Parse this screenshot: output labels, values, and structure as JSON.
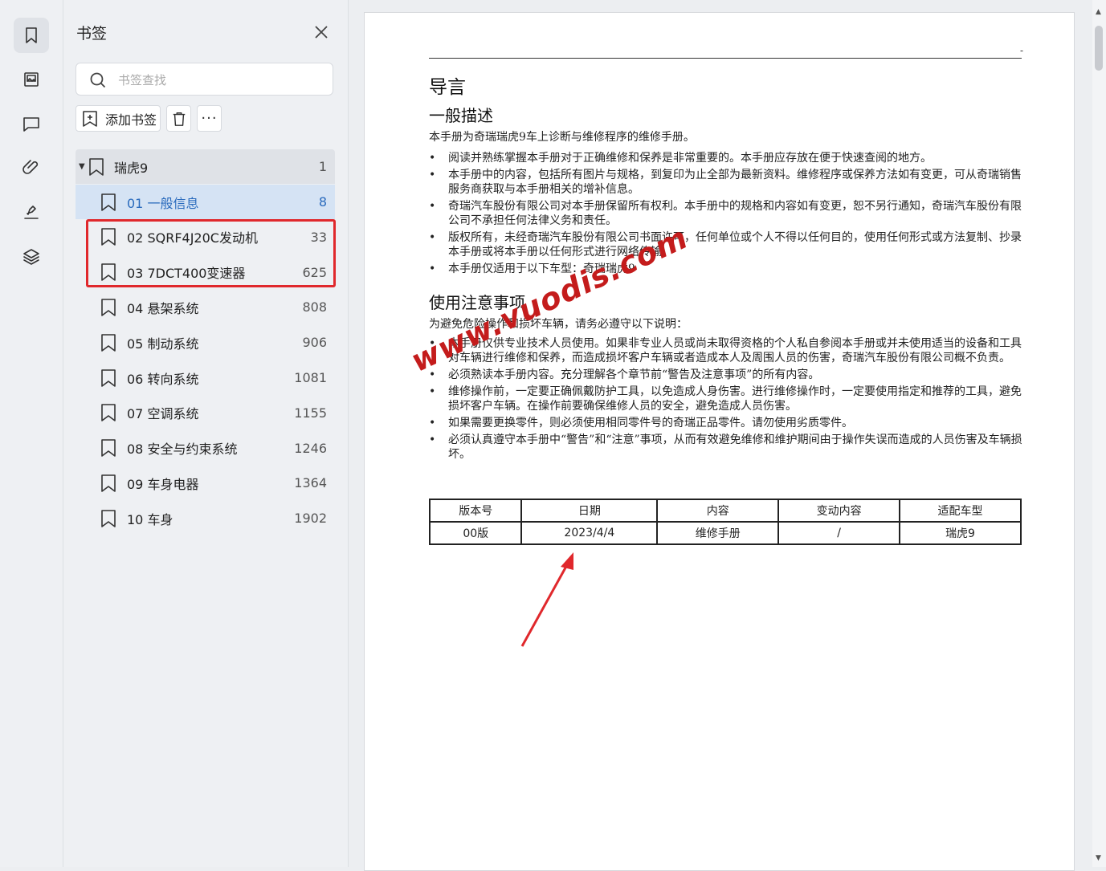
{
  "rail": {
    "items": [
      {
        "name": "bookmark-icon",
        "active": true
      },
      {
        "name": "image-icon",
        "active": false
      },
      {
        "name": "comment-icon",
        "active": false
      },
      {
        "name": "attachment-icon",
        "active": false
      },
      {
        "name": "signature-icon",
        "active": false
      },
      {
        "name": "layers-icon",
        "active": false
      }
    ]
  },
  "panel": {
    "title": "书签",
    "search_placeholder": "书签查找",
    "add_label": "添加书签",
    "more_label": "···"
  },
  "bookmarks": {
    "root": {
      "label": "瑞虎9",
      "page": "1",
      "expanded": true
    },
    "children": [
      {
        "label": "01 一般信息",
        "page": "8",
        "selected": true
      },
      {
        "label": "02 SQRF4J20C发动机",
        "page": "33"
      },
      {
        "label": "03 7DCT400变速器",
        "page": "625"
      },
      {
        "label": "04 悬架系统",
        "page": "808"
      },
      {
        "label": "05 制动系统",
        "page": "906"
      },
      {
        "label": "06 转向系统",
        "page": "1081"
      },
      {
        "label": "07 空调系统",
        "page": "1155"
      },
      {
        "label": "08 安全与约束系统",
        "page": "1246"
      },
      {
        "label": "09 车身电器",
        "page": "1364"
      },
      {
        "label": "10 车身",
        "page": "1902"
      }
    ]
  },
  "document": {
    "dash": "-",
    "h1": "导言",
    "section1_title": "一般描述",
    "section1_intro": "本手册为奇瑞瑞虎9车上诊断与维修程序的维修手册。",
    "section1_bullets": [
      "阅读并熟练掌握本手册对于正确维修和保养是非常重要的。本手册应存放在便于快速查阅的地方。",
      "本手册中的内容，包括所有图片与规格，到复印为止全部为最新资料。维修程序或保养方法如有变更，可从奇瑞销售服务商获取与本手册相关的增补信息。",
      "奇瑞汽车股份有限公司对本手册保留所有权利。本手册中的规格和内容如有变更，恕不另行通知，奇瑞汽车股份有限公司不承担任何法律义务和责任。",
      "版权所有，未经奇瑞汽车股份有限公司书面许可，任何单位或个人不得以任何目的，使用任何形式或方法复制、抄录本手册或将本手册以任何形式进行网络传输。",
      "本手册仅适用于以下车型：奇瑞瑞虎9"
    ],
    "section2_title": "使用注意事项",
    "section2_intro": "为避免危险操作和损坏车辆，请务必遵守以下说明：",
    "section2_bullets": [
      "本手册仅供专业技术人员使用。如果非专业人员或尚未取得资格的个人私自参阅本手册或并未使用适当的设备和工具对车辆进行维修和保养，而造成损坏客户车辆或者造成本人及周围人员的伤害，奇瑞汽车股份有限公司概不负责。",
      "必须熟读本手册内容。充分理解各个章节前“警告及注意事项”的所有内容。",
      "维修操作前，一定要正确佩戴防护工具，以免造成人身伤害。进行维修操作时，一定要使用指定和推荐的工具，避免损坏客户车辆。在操作前要确保维修人员的安全，避免造成人员伤害。",
      "如果需要更换零件，则必须使用相同零件号的奇瑞正品零件。请勿使用劣质零件。",
      "必须认真遵守本手册中“警告”和“注意”事项，从而有效避免维修和维护期间由于操作失误而造成的人员伤害及车辆损坏。"
    ],
    "table": {
      "headers": [
        "版本号",
        "日期",
        "内容",
        "变动内容",
        "适配车型"
      ],
      "row": [
        "00版",
        "2023/4/4",
        "维修手册",
        "/",
        "瑞虎9"
      ]
    }
  },
  "watermark": "www.vuodis.com",
  "colors": {
    "accent": "#2a6bbd",
    "highlight": "#e0282c",
    "selected_bg": "#d5e3f4"
  }
}
